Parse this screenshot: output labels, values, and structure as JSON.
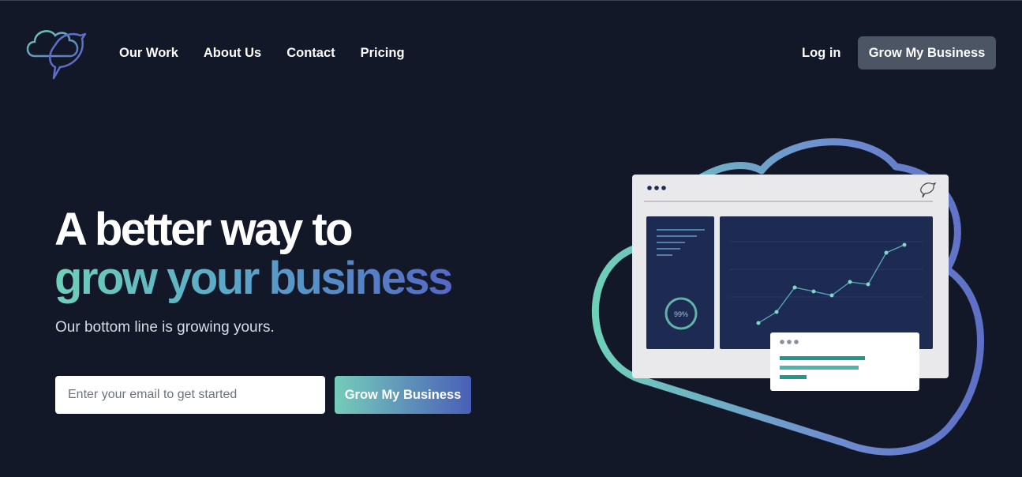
{
  "brand": {
    "logo_icon": "bird-cloud-logo-icon",
    "gradient": [
      "#6fd0b8",
      "#5468c4"
    ]
  },
  "nav": {
    "items": [
      {
        "label": "Our Work"
      },
      {
        "label": "About Us"
      },
      {
        "label": "Contact"
      },
      {
        "label": "Pricing"
      }
    ],
    "login_label": "Log in",
    "cta_label": "Grow My Business"
  },
  "hero": {
    "title_line1": "A better way to",
    "title_line2": "grow your business",
    "subtitle": "Our bottom line is growing yours.",
    "email_placeholder": "Enter your email to get started",
    "cta_label": "Grow My Business"
  },
  "illustration": {
    "progress_label": "99%",
    "progress_value": 0.99,
    "colors": {
      "teal": "#6fd0b8",
      "indigo": "#5e6fc6",
      "panel": "#1d2b52"
    }
  }
}
